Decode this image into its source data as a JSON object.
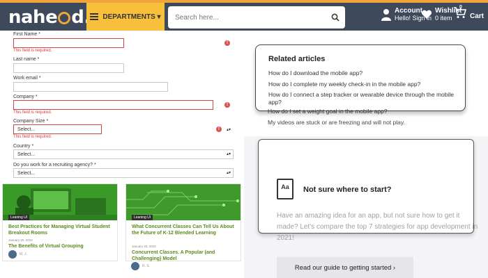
{
  "header": {
    "logo_left": "nahe",
    "logo_right": "d.pk",
    "departments_label": "DEPARTMENTS ▾",
    "search_placeholder": "Search here...",
    "account_label": "Account",
    "account_sub": "Hello! Sign in",
    "wishlist_label": "Wishlist",
    "wishlist_sub": "0 item",
    "cart_label": "Cart",
    "cart_count": "0",
    "icons": [
      "menu-icon",
      "search-icon",
      "user-icon",
      "heart-icon",
      "cart-icon"
    ],
    "colors": {
      "bar": "#3e4a5c",
      "accent": "#f7bf3a",
      "top_stripe": "#f0a43a"
    }
  },
  "form": {
    "first_name_label": "First Name *",
    "first_name_error": "This field is required.",
    "last_name_label": "Last name *",
    "work_email_label": "Work email *",
    "company_label": "Company *",
    "company_error": "This field is required.",
    "company_size_label": "Company Size *",
    "company_size_value": "Select...",
    "company_size_error": "This field is required.",
    "country_label": "Country *",
    "country_value": "Select...",
    "recruiting_label": "Do you work for a recruiting agency? *",
    "recruiting_value": "Select...",
    "error_badge": "!",
    "stepper_glyph": "▴\n▾"
  },
  "blog": {
    "cards": [
      {
        "tag": "Leaning UI",
        "title": "Best Practices for Managing Virtual Student Breakout Rooms",
        "date": "January 20, 2022",
        "subtitle": "The Benefits of Virtual Grouping",
        "author": "M. J."
      },
      {
        "tag": "Leaning UI",
        "title": "What Concurrent Classes Can Tell Us About the Future of K-12 Blended Learning",
        "date": "January 20, 2022",
        "subtitle": "Concurrent Classes. A Popular (and Challenging) Model",
        "author": "R. S."
      }
    ]
  },
  "related": {
    "heading": "Related articles",
    "links": [
      "How do I download the mobile app?",
      "How do I complete my weekly check-in in the mobile app?",
      "How do I connect a step tracker or wearable device through the mobile app?",
      "How do I set a weight goal in the mobile app?",
      "My videos are stuck or are freezing and will not play."
    ]
  },
  "guide": {
    "icon_text": "Aa",
    "title": "Not sure where to start?",
    "description": "Have an amazing idea for an app, but not sure how to get it made? Let's compare the top 7 strategies for app development in 2021!",
    "button_label": "Read our guide to getting started ›"
  }
}
